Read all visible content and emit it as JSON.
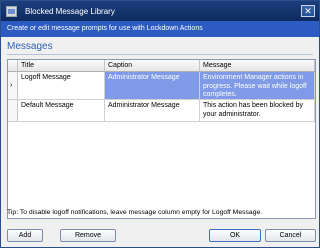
{
  "window": {
    "title": "Blocked Message Library",
    "close_glyph": "✕"
  },
  "banner": {
    "text": "Create or edit message prompts for use with Lockdown Actions"
  },
  "section": {
    "title": "Messages"
  },
  "grid": {
    "columns": [
      "Title",
      "Caption",
      "Message"
    ],
    "rows": [
      {
        "title": "Logoff Message",
        "caption": "Administrator Message",
        "message": "Environment Manager actions in progress. Please wait while logoff completes.",
        "selected": true
      },
      {
        "title": "Default Message",
        "caption": "Administrator Message",
        "message": "This action has been blocked by your administrator.",
        "selected": false
      }
    ],
    "current_row_glyph": "›"
  },
  "tip": "Tip: To disable logoff notifications, leave message column empty for Logoff Message.",
  "buttons": {
    "add": "Add",
    "remove": "Remove",
    "ok": "OK",
    "cancel": "Cancel"
  },
  "colors": {
    "titlebar": "#1d3f7d",
    "banner": "#2c5bc1",
    "accent": "#2e61b1",
    "selection": "#7f9ae6"
  }
}
